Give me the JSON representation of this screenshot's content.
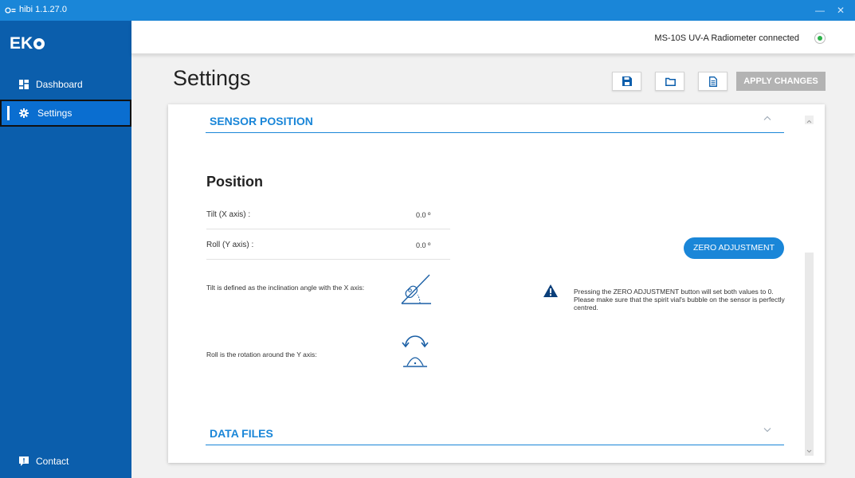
{
  "window": {
    "title": "hibi 1.1.27.0",
    "minimize_glyph": "—",
    "close_glyph": "✕"
  },
  "sidebar": {
    "logo_text": "EK",
    "items": [
      {
        "label": "Dashboard",
        "icon": "dashboard-icon",
        "active": false
      },
      {
        "label": "Settings",
        "icon": "gear-icon",
        "active": true
      }
    ],
    "footer_item": {
      "label": "Contact",
      "icon": "chat-icon"
    }
  },
  "header": {
    "connection_text": "MS-10S UV-A Radiometer connected",
    "connection_status_color": "#2db24a"
  },
  "page": {
    "title": "Settings"
  },
  "toolbar": {
    "save_icon": "save-icon",
    "open_icon": "folder-icon",
    "report_icon": "document-icon",
    "apply_label": "APPLY CHANGES"
  },
  "sections": {
    "sensor_position": {
      "title": "SENSOR POSITION",
      "expanded": true
    },
    "data_files": {
      "title": "DATA FILES",
      "expanded": false
    }
  },
  "position": {
    "heading": "Position",
    "tilt_label": "Tilt  (X axis) :",
    "tilt_value": "0.0 º",
    "roll_label": "Roll (Y axis) :",
    "roll_value": "0.0 º",
    "tilt_description": "Tilt is defined as the inclination angle with the X axis:",
    "roll_description": "Roll is the rotation around the Y axis:",
    "zero_button_label": "ZERO ADJUSTMENT",
    "warning_text": "Pressing the ZERO ADJUSTMENT button will set both values to 0.  Please make sure that the spirit vial's bubble on the sensor is perfectly centred."
  },
  "colors": {
    "accent": "#1a86d8",
    "sidebar_bg": "#0b5eac",
    "apply_disabled": "#b3b3b3",
    "warning_icon": "#0b3f7a"
  }
}
